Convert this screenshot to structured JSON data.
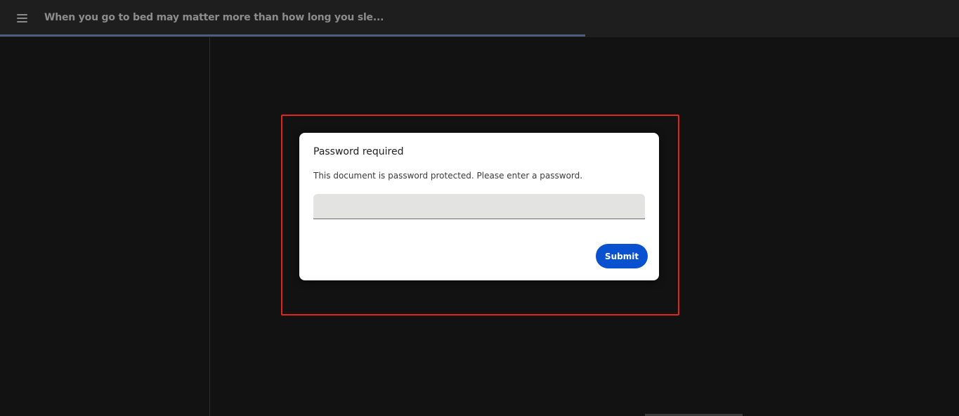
{
  "toolbar": {
    "menu_icon": "hamburger-menu-icon",
    "document_title": "When you go to bed may matter more than how long you sle..."
  },
  "progress": {
    "fraction": 0.61
  },
  "dialog": {
    "title": "Password required",
    "message": "This document is password protected. Please enter a password.",
    "password_value": "",
    "submit_label": "Submit"
  },
  "colors": {
    "background": "#121212",
    "toolbar": "#1e1e1e",
    "progress": "#4a5f80",
    "highlight": "#e3241b",
    "primary_button": "#0a51d0"
  }
}
